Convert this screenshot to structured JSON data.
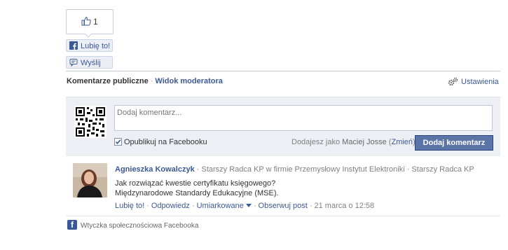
{
  "like_box": {
    "count": "1"
  },
  "buttons": {
    "like": "Lubię to!",
    "send": "Wyślij"
  },
  "tabs": {
    "active": "Komentarze publiczne",
    "separator": "·",
    "moderator": "Widok moderatora"
  },
  "settings": {
    "label": "Ustawienia"
  },
  "composer": {
    "placeholder": "Dodaj komentarz...",
    "publish_label": "Opublikuj na Facebooku",
    "posting_as_prefix": "Dodajesz jako",
    "posting_as_name": "Maciej Josse",
    "change_label": "Zmień",
    "submit_label": "Dodaj komentarz"
  },
  "comment": {
    "author": "Agnieszka Kowalczyk",
    "meta": "· Starszy Radca KP w firmie Przemysłowy Instytut Elektroniki · Starszy Radca KP",
    "line1": "Jak rozwiązać kwestie certyfikatu księgowego?",
    "line2": "Międzynarodowe Standardy Edukacyjne (MSE).",
    "action_like": "Lubię to!",
    "action_reply": "Odpowiedz",
    "action_moderate": "Umiarkowane",
    "action_follow": "Obserwuj post",
    "timestamp": "21 marca o 12:58"
  },
  "footer": {
    "plugin_label": "Wtyczka społecznościowa Facebooka"
  },
  "colors": {
    "link": "#3b5998",
    "button": "#5b74a8",
    "panel": "#edeff4"
  }
}
